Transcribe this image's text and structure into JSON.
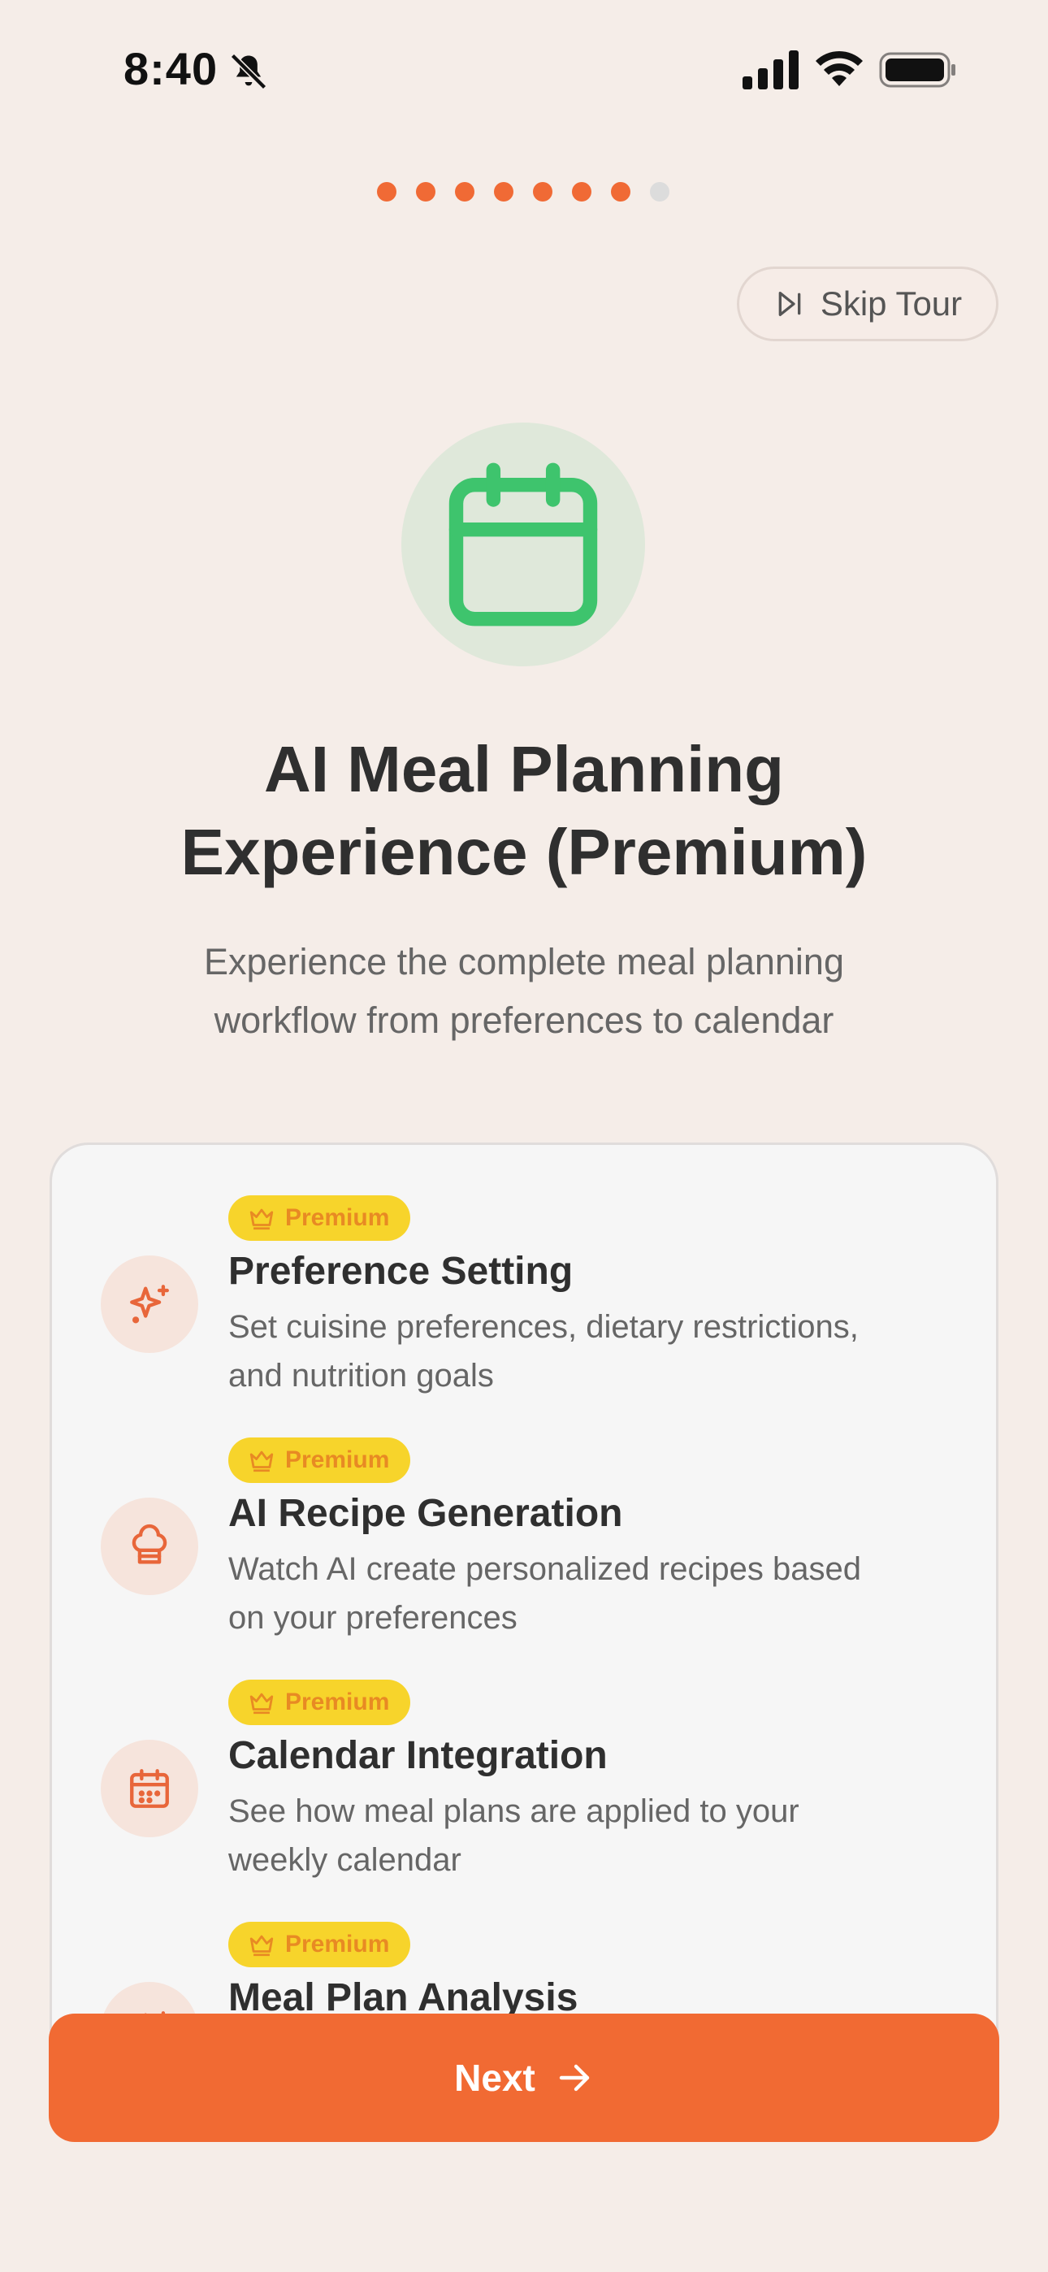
{
  "status_bar": {
    "time": "8:40"
  },
  "progress": {
    "total_steps": 8,
    "current_step": 7
  },
  "skip_tour": {
    "label": "Skip Tour"
  },
  "hero": {
    "icon": "calendar-icon",
    "title_line1": "AI Meal Planning",
    "title_line2": "Experience (Premium)",
    "subtitle_line1": "Experience the complete meal planning",
    "subtitle_line2": "workflow from preferences to calendar"
  },
  "features": [
    {
      "badge": "Premium",
      "icon": "sparkle-icon",
      "title": "Preference Setting",
      "desc_line1": "Set cuisine preferences, dietary restrictions,",
      "desc_line2": "and nutrition goals"
    },
    {
      "badge": "Premium",
      "icon": "chef-hat-icon",
      "title": "AI Recipe Generation",
      "desc_line1": "Watch AI create personalized recipes based",
      "desc_line2": "on your preferences"
    },
    {
      "badge": "Premium",
      "icon": "calendar-icon",
      "title": "Calendar Integration",
      "desc_line1": "See how meal plans are applied to your",
      "desc_line2": "weekly calendar"
    },
    {
      "badge": "Premium",
      "icon": "sparkle-icon",
      "title": "Meal Plan Analysis",
      "desc_line1": "",
      "desc_line2": ""
    }
  ],
  "next_button": {
    "label": "Next"
  },
  "colors": {
    "background": "#f5ede8",
    "accent": "#f16a33",
    "hero_icon": "#3ec46d",
    "badge_bg": "#f7d42b",
    "badge_text": "#e88a23"
  }
}
